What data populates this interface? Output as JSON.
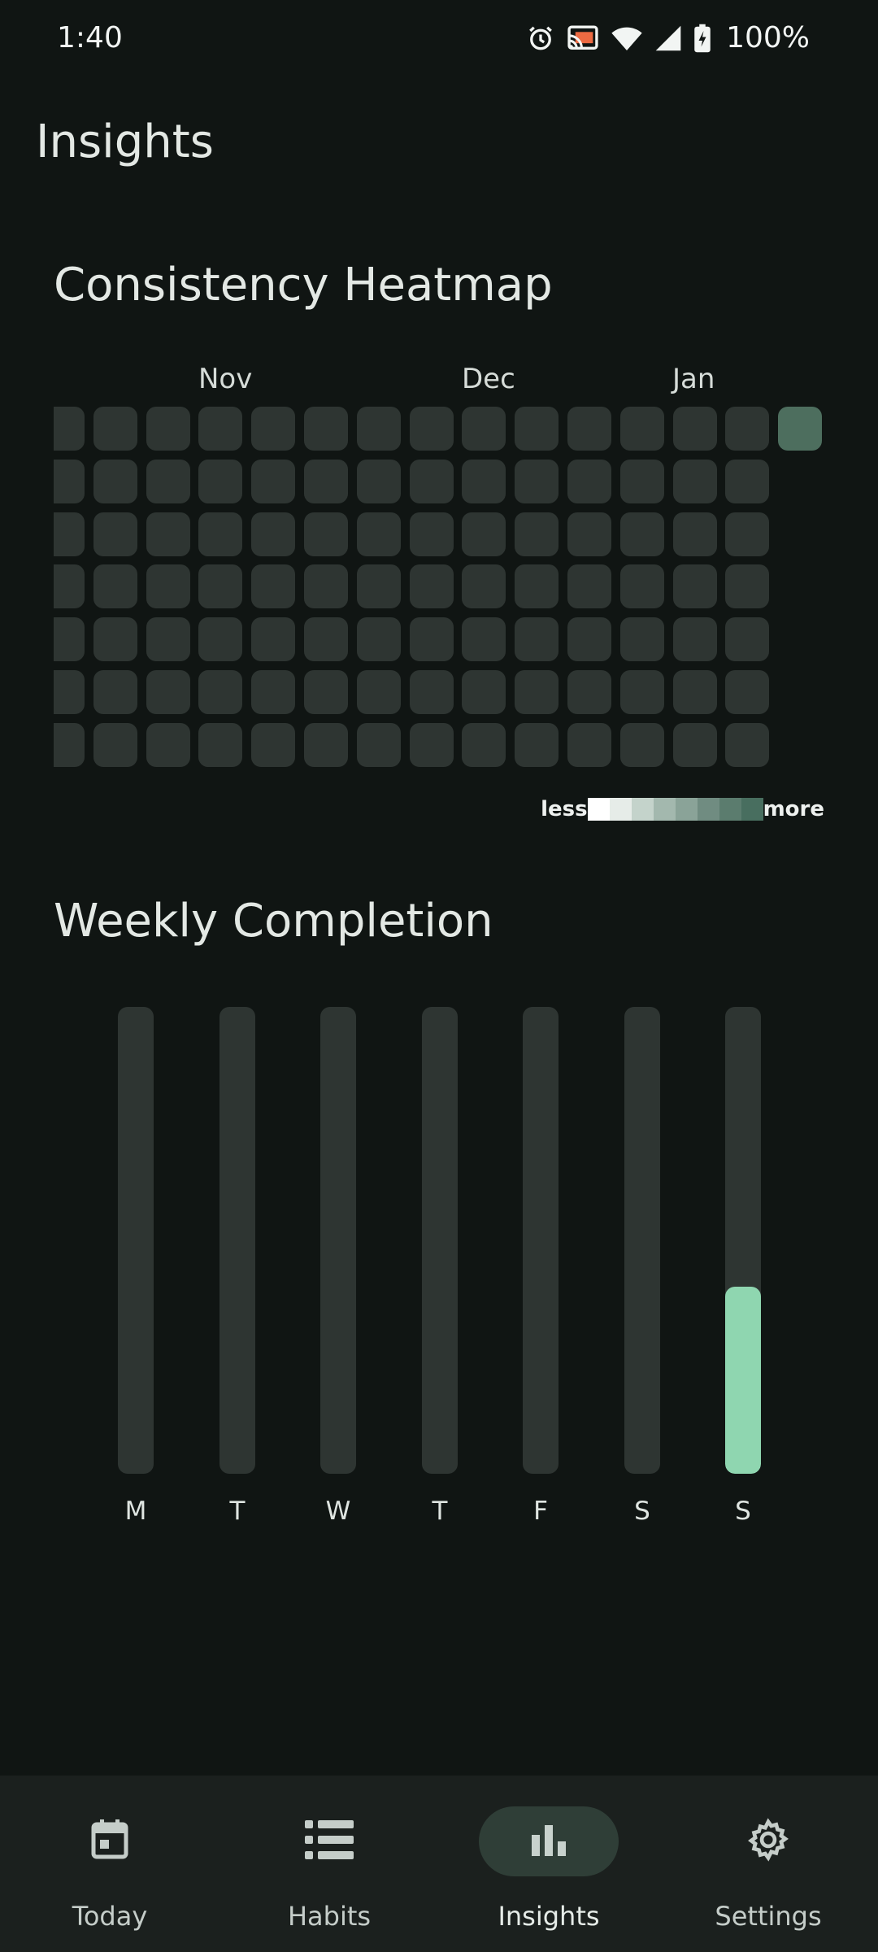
{
  "status_bar": {
    "time": "1:40",
    "battery": "100%",
    "icons": [
      "alarm-icon",
      "cast-icon",
      "wifi-icon",
      "signal-icon",
      "battery-charging-icon"
    ]
  },
  "page": {
    "title": "Insights"
  },
  "heatmap": {
    "title": "Consistency Heatmap",
    "months": [
      "Nov",
      "Dec",
      "Jan"
    ],
    "weeks": 15,
    "days_per_week": 7,
    "active_cells": [
      {
        "week": 14,
        "day": 0,
        "level": 1
      }
    ],
    "legend": {
      "less": "less",
      "more": "more",
      "swatch_colors": [
        "#ffffff",
        "#e6ece8",
        "#c4d3cb",
        "#a3b8ae",
        "#8aa398",
        "#708c81",
        "#5b7c6e",
        "#486e5f"
      ]
    },
    "colors": {
      "empty": "#2e3532",
      "active": "#4d6e5e"
    }
  },
  "weekly": {
    "title": "Weekly Completion",
    "days": [
      "M",
      "T",
      "W",
      "T",
      "F",
      "S",
      "S"
    ],
    "completion": [
      0,
      0,
      0,
      0,
      0,
      0,
      0.4
    ],
    "colors": {
      "track": "#2e3532",
      "fill": "#8fd6b0"
    }
  },
  "nav": {
    "items": [
      {
        "label": "Today",
        "icon": "calendar-icon",
        "active": false
      },
      {
        "label": "Habits",
        "icon": "list-icon",
        "active": false
      },
      {
        "label": "Insights",
        "icon": "bar-chart-icon",
        "active": true
      },
      {
        "label": "Settings",
        "icon": "gear-icon",
        "active": false
      }
    ]
  }
}
